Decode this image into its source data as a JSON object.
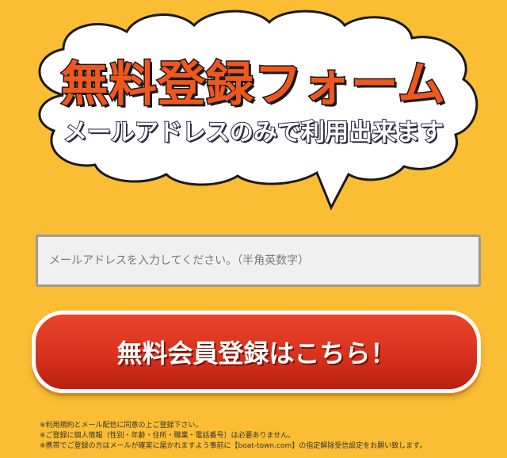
{
  "title": "無料登録フォーム",
  "subtitle": "メールアドレスのみで利用出来ます",
  "email": {
    "value": "",
    "placeholder": "メールアドレスを入力してください。（半角英数字）"
  },
  "register_button": {
    "label": "無料会員登録はこちら！"
  },
  "notes": [
    "※利用規約とメール配信に同意の上ご登録下さい。",
    "※ご登録に個人情報（性別・年齢・住所・職業・電話番号）は必要ありません。",
    "※携帯でご登録の方はメールが確実に届かれますよう事前に【boat-town.com】の指定解除受信設定をお願い致します。"
  ],
  "colors": {
    "background": "#fbbd33",
    "title": "#f0571e",
    "button": "#d8321e"
  }
}
